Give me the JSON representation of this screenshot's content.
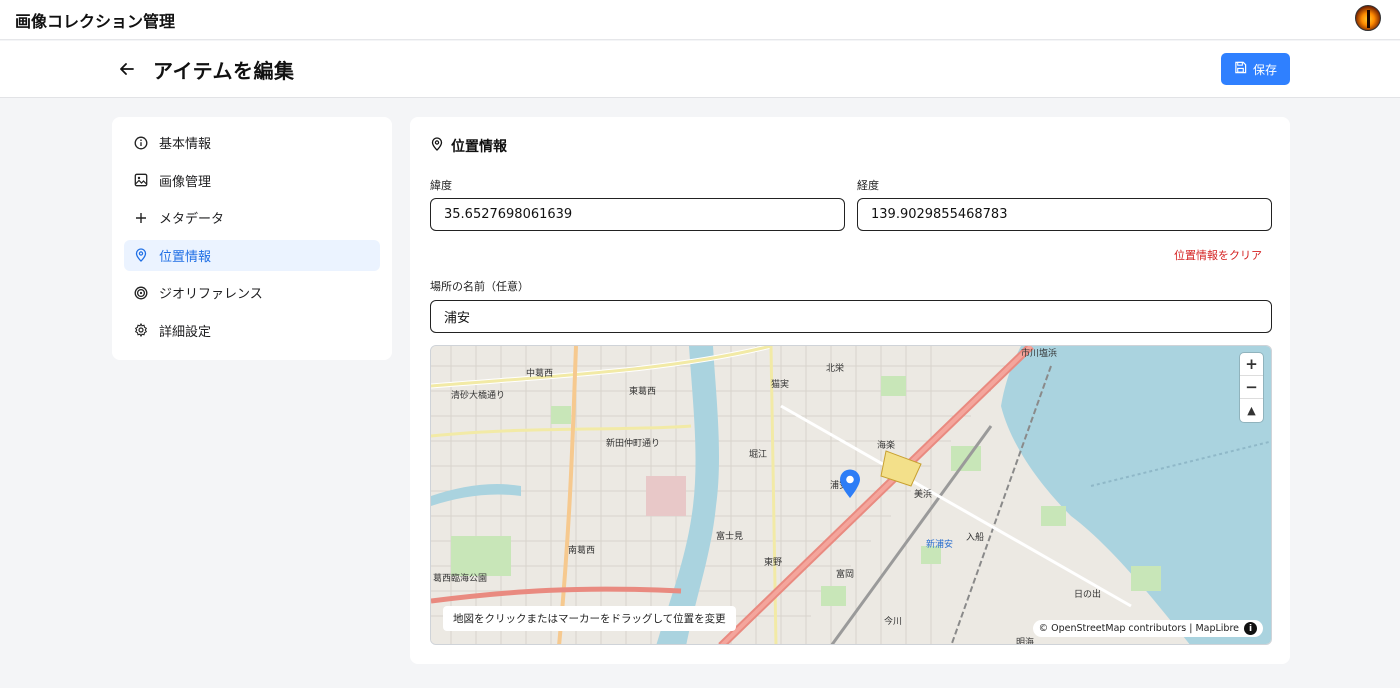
{
  "app": {
    "title": "画像コレクション管理"
  },
  "header": {
    "page_title": "アイテムを編集",
    "save_label": "保存"
  },
  "sidebar": {
    "items": [
      {
        "label": "基本情報",
        "icon": "info-icon",
        "active": false
      },
      {
        "label": "画像管理",
        "icon": "image-icon",
        "active": false
      },
      {
        "label": "メタデータ",
        "icon": "plus-icon",
        "active": false
      },
      {
        "label": "位置情報",
        "icon": "map-pin-icon",
        "active": true
      },
      {
        "label": "ジオリファレンス",
        "icon": "target-icon",
        "active": false
      },
      {
        "label": "詳細設定",
        "icon": "gear-icon",
        "active": false
      }
    ]
  },
  "location": {
    "section_title": "位置情報",
    "latitude_label": "緯度",
    "latitude_value": "35.6527698061639",
    "longitude_label": "経度",
    "longitude_value": "139.9029855468783",
    "clear_label": "位置情報をクリア",
    "place_name_label": "場所の名前（任意）",
    "place_name_value": "浦安"
  },
  "map": {
    "hint": "地図をクリックまたはマーカーをドラッグして位置を変更",
    "attribution": "© OpenStreetMap contributors | MapLibre",
    "zoom_in": "+",
    "zoom_out": "−",
    "compass": "▲",
    "info": "i",
    "labels": [
      "中葛西",
      "東葛西",
      "清砂大橋通り",
      "新田仲町通り",
      "南葛西",
      "富士見",
      "東野",
      "富岡",
      "今川",
      "北栄",
      "猫実",
      "堀江",
      "海楽",
      "美浜",
      "入船",
      "新浦安",
      "日の出",
      "明海",
      "浦安",
      "市川塩浜",
      "葛西臨海公園"
    ],
    "marker_color": "#2d7df6"
  },
  "colors": {
    "accent": "#2f80ff",
    "danger": "#d42020",
    "active_bg": "#ebf3ff",
    "water": "#aad3df"
  }
}
